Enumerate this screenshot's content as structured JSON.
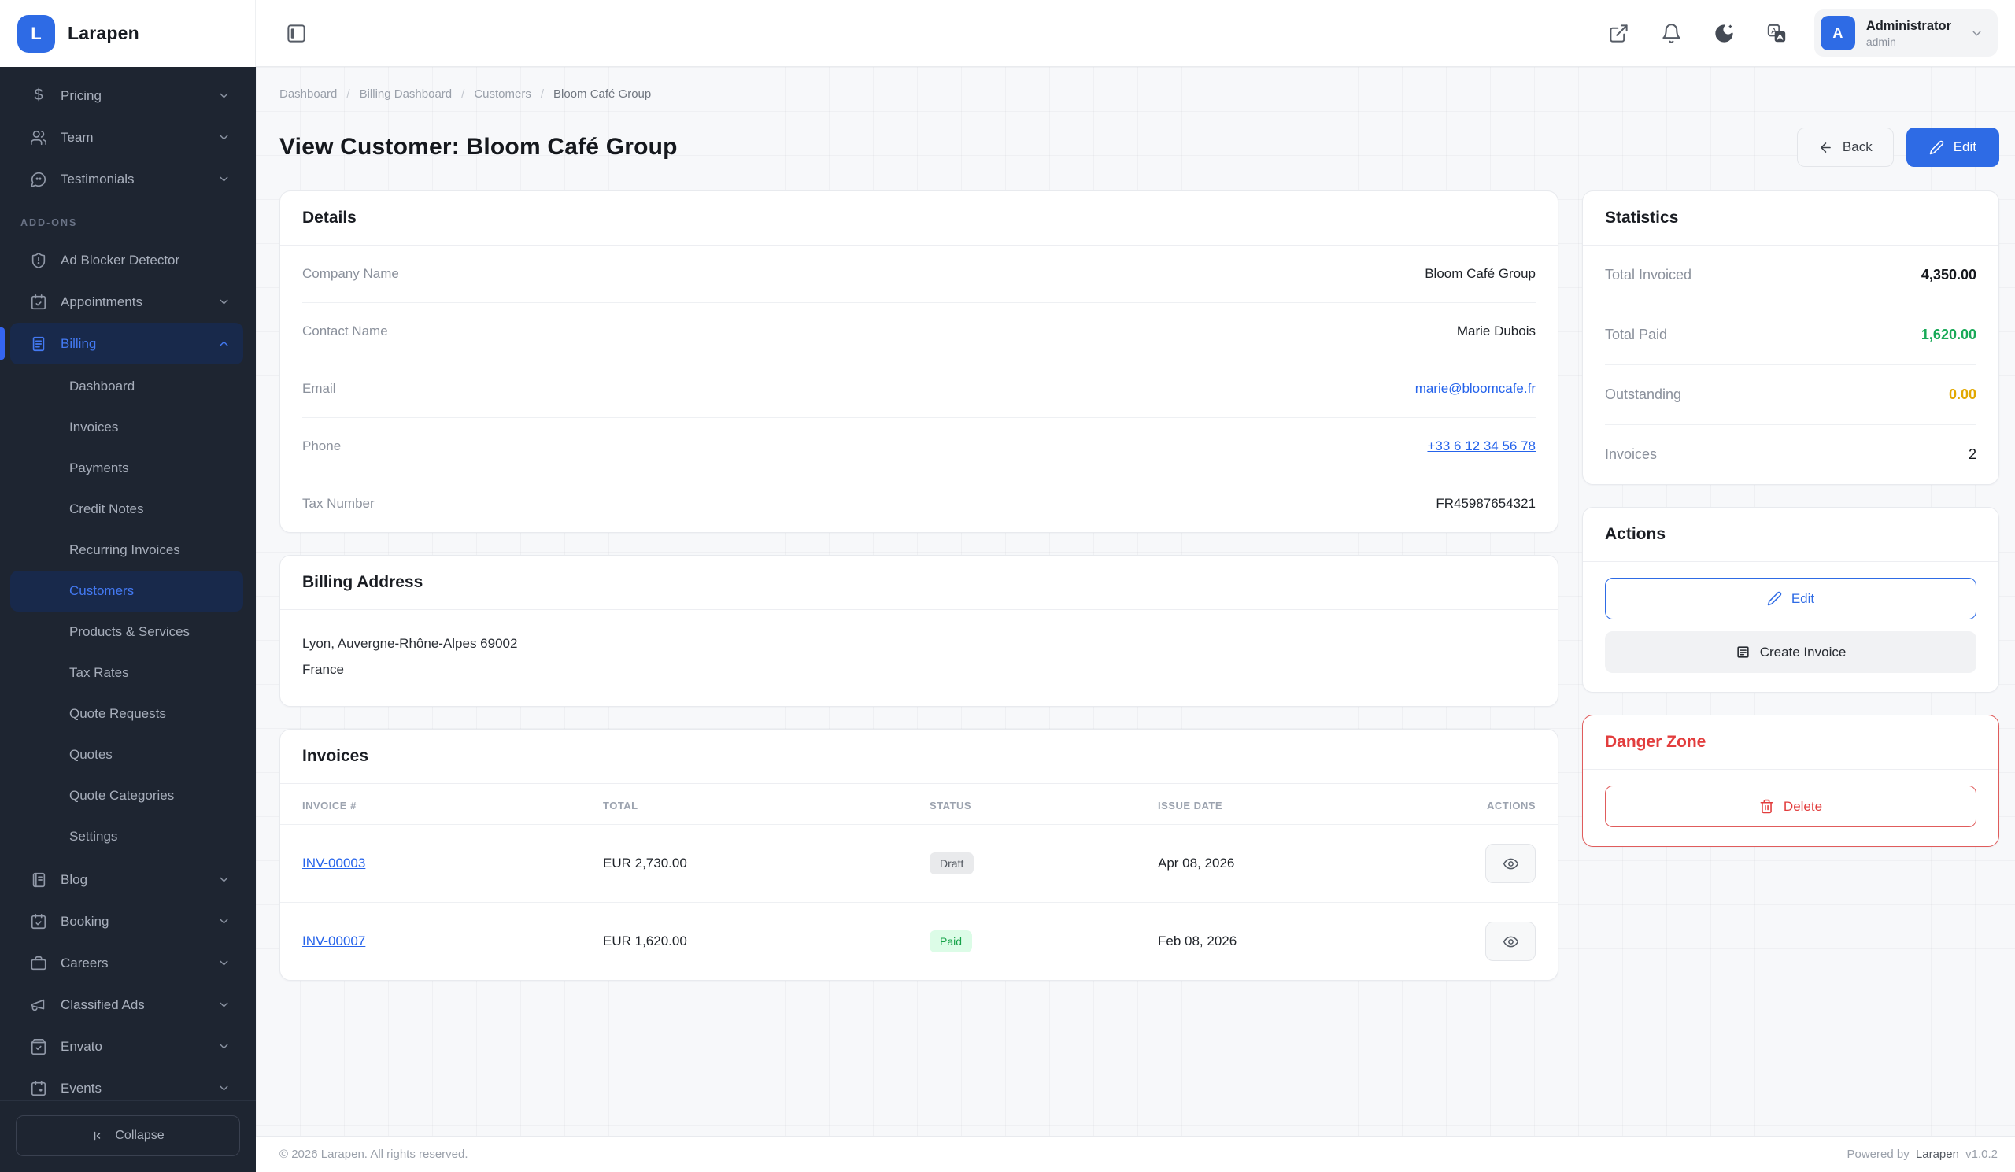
{
  "brand": {
    "name": "Larapen",
    "logo_letter": "L"
  },
  "topbar": {
    "user": {
      "name": "Administrator",
      "role": "admin",
      "avatar_letter": "A"
    }
  },
  "sidebar": {
    "main_items": [
      {
        "label": "Pricing"
      },
      {
        "label": "Team"
      },
      {
        "label": "Testimonials"
      }
    ],
    "addons_label": "ADD-ONS",
    "addon_items": [
      {
        "label": "Ad Blocker Detector"
      },
      {
        "label": "Appointments"
      },
      {
        "label": "Billing"
      }
    ],
    "billing_submenu": [
      "Dashboard",
      "Invoices",
      "Payments",
      "Credit Notes",
      "Recurring Invoices",
      "Customers",
      "Products & Services",
      "Tax Rates",
      "Quote Requests",
      "Quotes",
      "Quote Categories",
      "Settings"
    ],
    "bottom_items": [
      {
        "label": "Blog"
      },
      {
        "label": "Booking"
      },
      {
        "label": "Careers"
      },
      {
        "label": "Classified Ads"
      },
      {
        "label": "Envato"
      },
      {
        "label": "Events"
      }
    ],
    "collapse_label": "Collapse"
  },
  "breadcrumb": {
    "items": [
      "Dashboard",
      "Billing Dashboard",
      "Customers",
      "Bloom Café Group"
    ],
    "separator": "/"
  },
  "page": {
    "title": "View Customer: Bloom Café Group",
    "back_label": "Back",
    "edit_label": "Edit"
  },
  "details": {
    "title": "Details",
    "rows": [
      {
        "label": "Company Name",
        "value": "Bloom Café Group"
      },
      {
        "label": "Contact Name",
        "value": "Marie Dubois"
      },
      {
        "label": "Email",
        "value": "marie@bloomcafe.fr"
      },
      {
        "label": "Phone",
        "value": "+33 6 12 34 56 78"
      },
      {
        "label": "Tax Number",
        "value": "FR45987654321"
      }
    ]
  },
  "billing_address": {
    "title": "Billing Address",
    "line1": "Lyon, Auvergne-Rhône-Alpes 69002",
    "line2": "France"
  },
  "invoices": {
    "title": "Invoices",
    "columns": [
      "INVOICE #",
      "TOTAL",
      "STATUS",
      "ISSUE DATE",
      "ACTIONS"
    ],
    "rows": [
      {
        "number": "INV-00003",
        "total": "EUR 2,730.00",
        "status": "Draft",
        "issue_date": "Apr 08, 2026"
      },
      {
        "number": "INV-00007",
        "total": "EUR 1,620.00",
        "status": "Paid",
        "issue_date": "Feb 08, 2026"
      }
    ]
  },
  "statistics": {
    "title": "Statistics",
    "rows": [
      {
        "label": "Total Invoiced",
        "value": "4,350.00"
      },
      {
        "label": "Total Paid",
        "value": "1,620.00"
      },
      {
        "label": "Outstanding",
        "value": "0.00"
      },
      {
        "label": "Invoices",
        "value": "2"
      }
    ]
  },
  "actions": {
    "title": "Actions",
    "edit_label": "Edit",
    "create_invoice_label": "Create Invoice"
  },
  "danger_zone": {
    "title": "Danger Zone",
    "delete_label": "Delete"
  },
  "footer": {
    "left": "© 2026 Larapen. All rights reserved.",
    "powered_prefix": "Powered by",
    "brand": "Larapen",
    "version": "v1.0.2"
  },
  "colors": {
    "accent": "#2e6be5",
    "green": "#18a957",
    "amber": "#e2a800",
    "danger": "#e23d3d",
    "sidebar_bg": "#1e2531"
  }
}
